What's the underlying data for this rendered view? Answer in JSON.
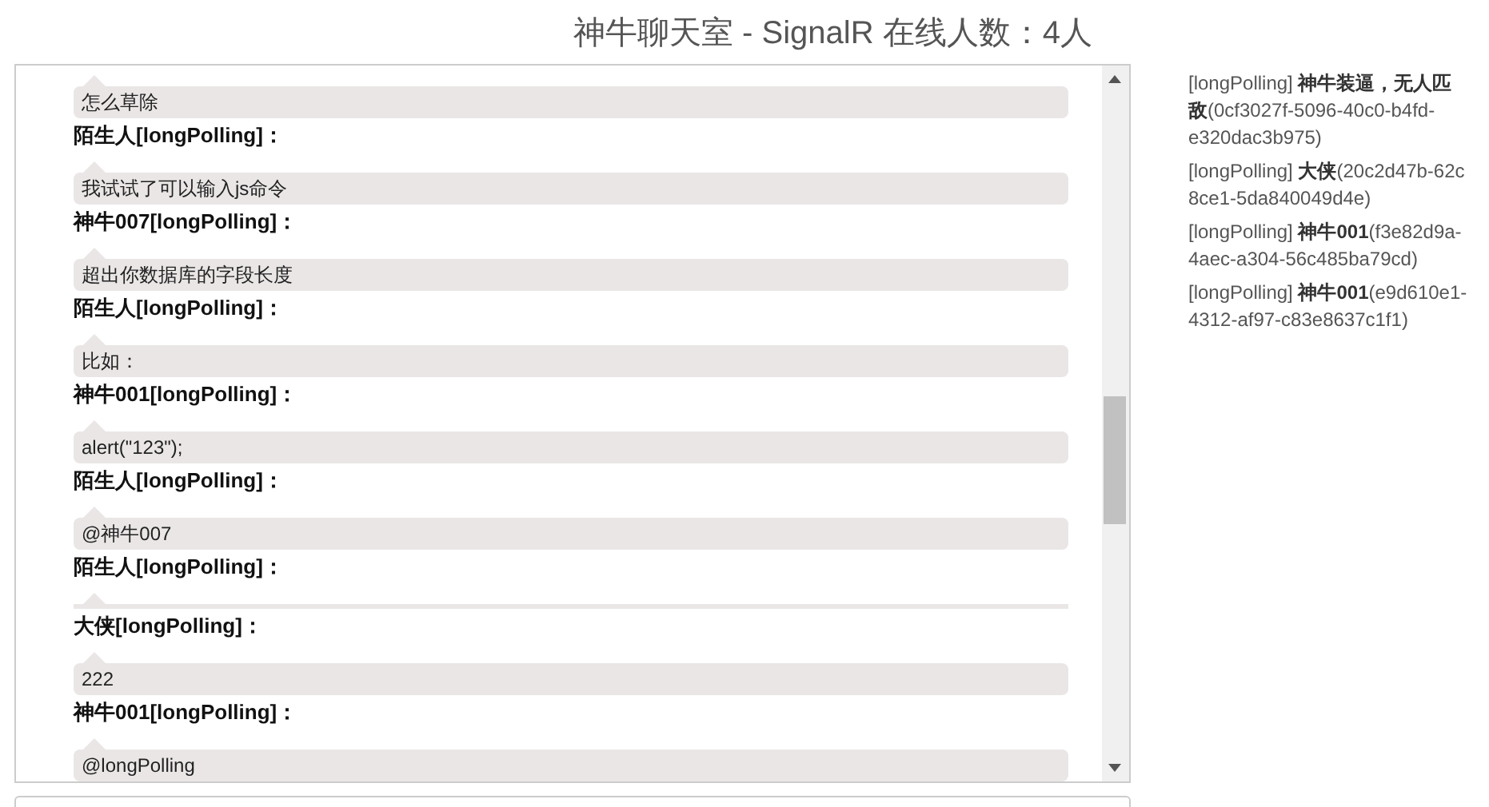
{
  "title": "神牛聊天室 - SignalR 在线人数：4人",
  "messages": [
    {
      "kind": "message",
      "text": "怎么草除"
    },
    {
      "kind": "sender",
      "text": "陌生人[longPolling]："
    },
    {
      "kind": "message",
      "text": "我试试了可以输入js命令"
    },
    {
      "kind": "sender",
      "text": "神牛007[longPolling]："
    },
    {
      "kind": "message",
      "text": "超出你数据库的字段长度"
    },
    {
      "kind": "sender",
      "text": "陌生人[longPolling]："
    },
    {
      "kind": "message",
      "text": "比如："
    },
    {
      "kind": "sender",
      "text": "神牛001[longPolling]："
    },
    {
      "kind": "message",
      "text": "alert(\"123\");"
    },
    {
      "kind": "sender",
      "text": "陌生人[longPolling]："
    },
    {
      "kind": "message",
      "text": "@神牛007"
    },
    {
      "kind": "sender",
      "text": "陌生人[longPolling]："
    },
    {
      "kind": "blank"
    },
    {
      "kind": "sender",
      "text": "大侠[longPolling]："
    },
    {
      "kind": "message",
      "text": "222"
    },
    {
      "kind": "sender",
      "text": "神牛001[longPolling]："
    },
    {
      "kind": "message",
      "text": "@longPolling"
    }
  ],
  "users": [
    {
      "lines": [
        "[longPolling] **神牛装逼，无人匹**",
        "**敌**(0cf3027f-5096-40c0-b4fd-",
        "e320dac3b975)"
      ]
    },
    {
      "lines": [
        "[longPolling] **大侠**(20c2d47b-62c",
        "8ce1-5da840049d4e)"
      ]
    },
    {
      "lines": [
        "[longPolling] **神牛001**(f3e82d9a-",
        "4aec-a304-56c485ba79cd)"
      ]
    },
    {
      "lines": [
        "[longPolling] **神牛001**(e9d610e1-",
        "4312-af97-c83e8637c1f1)"
      ]
    }
  ]
}
